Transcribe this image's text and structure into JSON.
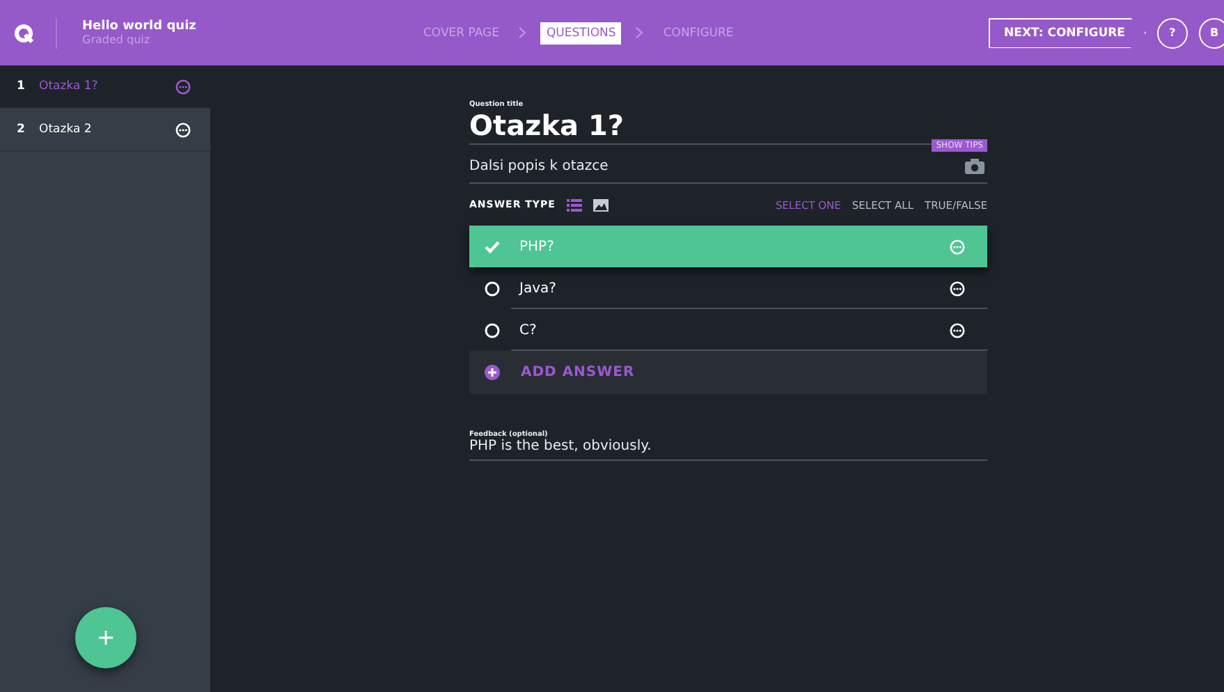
{
  "header": {
    "title": "Hello world quiz",
    "subtitle": "Graded quiz",
    "steps": [
      {
        "label": "COVER PAGE",
        "selected": false
      },
      {
        "label": "QUESTIONS",
        "selected": true
      },
      {
        "label": "CONFIGURE",
        "selected": false
      }
    ],
    "next_button": "NEXT: CONFIGURE",
    "help_button": "?",
    "avatar": "B"
  },
  "sidebar": {
    "questions": [
      {
        "number": "1",
        "label": "Otazka 1?",
        "selected": true
      },
      {
        "number": "2",
        "label": "Otazka 2",
        "selected": false
      }
    ]
  },
  "question": {
    "title_label": "Question title",
    "title": "Otazka 1?",
    "show_tips": "SHOW TIPS",
    "description": "Dalsi popis k otazce",
    "answer_type_label": "ANSWER TYPE",
    "view_modes": [
      {
        "kind": "list",
        "selected": true
      },
      {
        "kind": "image",
        "selected": false
      }
    ],
    "answer_types": [
      {
        "label": "SELECT ONE",
        "selected": true
      },
      {
        "label": "SELECT ALL",
        "selected": false
      },
      {
        "label": "TRUE/FALSE",
        "selected": false
      }
    ],
    "answers": [
      {
        "label": "PHP?",
        "correct": true
      },
      {
        "label": "Java?",
        "correct": false
      },
      {
        "label": "C?",
        "correct": false
      }
    ],
    "add_answer": "ADD ANSWER",
    "feedback_label": "Feedback (optional)",
    "feedback": "PHP is the best, obviously."
  }
}
